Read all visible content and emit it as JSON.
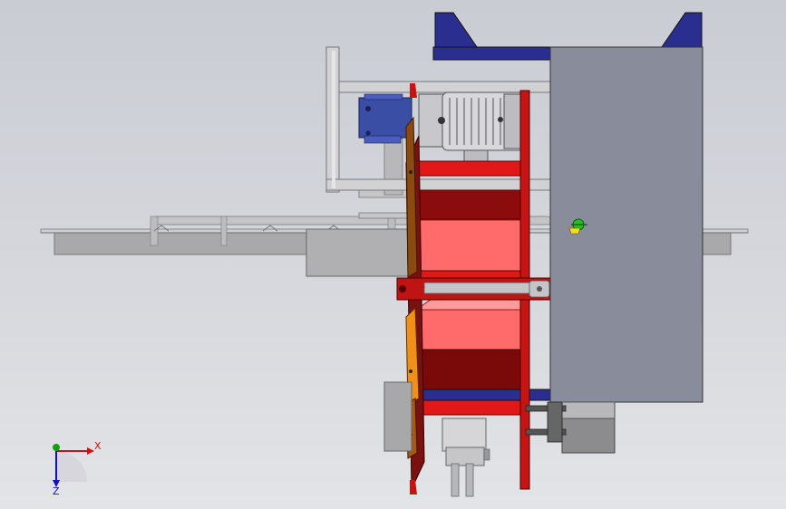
{
  "viewport": {
    "background_top": "#c9ccd3",
    "background_bottom": "#e3e4e7"
  },
  "colors": {
    "frame_blue": "#2a2f8f",
    "plate_gray": "#898c9a",
    "drum_red": "#e01818",
    "drum_pink": "#ff6a6a",
    "drum_dark": "#7a0a0a",
    "arm_orange": "#f0901a",
    "motor_blue": "#3a4ea6",
    "motor_silver": "#d8d8dc",
    "conveyor_gray": "#b3b3b3",
    "axis_x": "#d01010",
    "axis_y": "#10a010",
    "axis_z": "#1010d0",
    "origin_marker": "#22c022"
  },
  "triad": {
    "x_label": "X",
    "z_label": "Z"
  },
  "icons": [
    "coordinate-triad-icon",
    "origin-marker-icon"
  ]
}
